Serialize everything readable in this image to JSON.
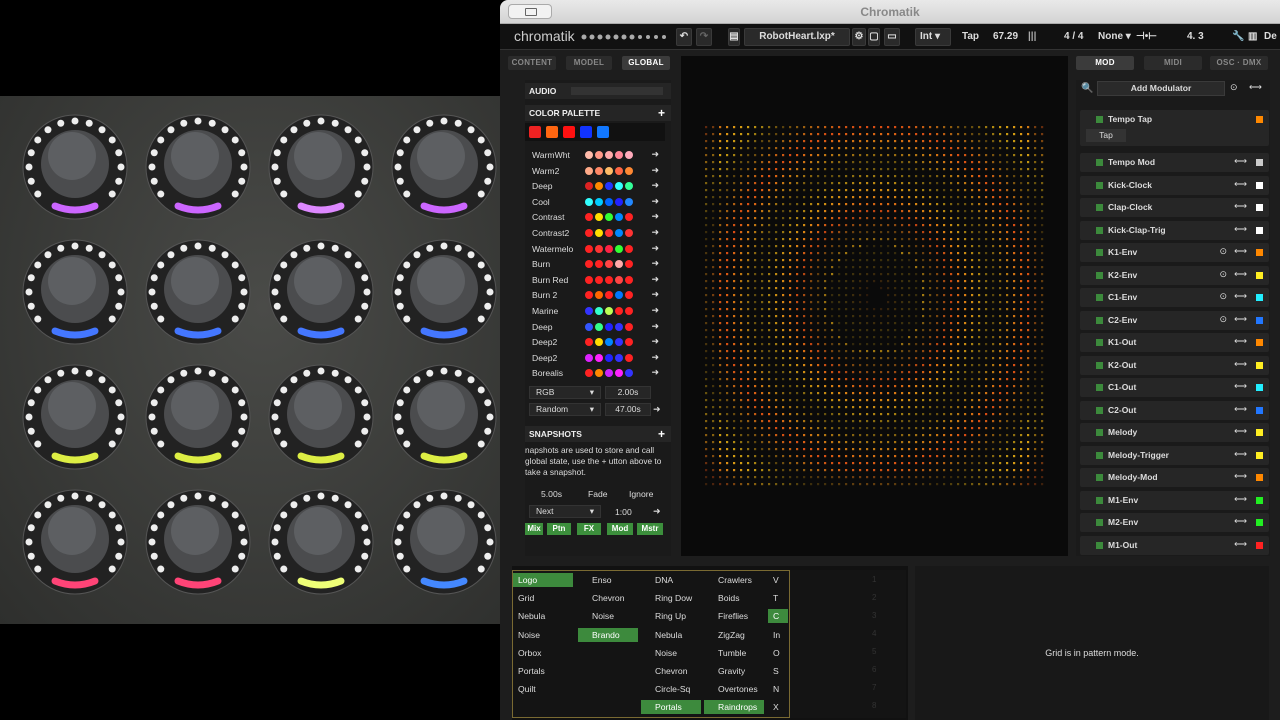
{
  "app": {
    "title": "Chromatik",
    "logo": "chromatik",
    "project": "RobotHeart.lxp*"
  },
  "toolbar": {
    "clock_mode": "Int",
    "tap": "Tap",
    "bpm": "67.29",
    "meter": "4 / 4",
    "sync": "None",
    "beat": "4. 3",
    "edge": "De"
  },
  "left_tabs": [
    "CONTENT",
    "MODEL",
    "GLOBAL"
  ],
  "right_tabs": [
    "MOD",
    "MIDI",
    "OSC · DMX"
  ],
  "audio": {
    "label": "AUDIO"
  },
  "color_palette": {
    "label": "COLOR PALETTE",
    "current": [
      "#ee2222",
      "#ff6611",
      "#ff1111",
      "#1133ff",
      "#1177ff"
    ],
    "palettes": [
      {
        "name": "WarmWht",
        "colors": [
          "#ffbbaa",
          "#ff9988",
          "#ffaaaa",
          "#ff8899",
          "#ffaabb"
        ]
      },
      {
        "name": "Warm2",
        "colors": [
          "#ffaa88",
          "#ff8866",
          "#ffbb66",
          "#ff6644",
          "#ff8833"
        ]
      },
      {
        "name": "Deep",
        "colors": [
          "#dd2222",
          "#ff8800",
          "#2233ff",
          "#33ffff",
          "#33ff99"
        ]
      },
      {
        "name": "Cool",
        "colors": [
          "#33ffff",
          "#00ccff",
          "#0066ff",
          "#2222ff",
          "#2288ff"
        ]
      },
      {
        "name": "Contrast",
        "colors": [
          "#ff2222",
          "#ffdd00",
          "#33ff33",
          "#0088ff",
          "#ff2222"
        ]
      },
      {
        "name": "Contrast2",
        "colors": [
          "#ff2222",
          "#ffdd00",
          "#ff3333",
          "#0088ff",
          "#ff3333"
        ]
      },
      {
        "name": "Watermelo",
        "colors": [
          "#ff2222",
          "#ff3333",
          "#ff2244",
          "#33ff33",
          "#ff2222"
        ]
      },
      {
        "name": "Burn",
        "colors": [
          "#ff2222",
          "#ff2222",
          "#ff4444",
          "#ffaaaa",
          "#ff2222"
        ]
      },
      {
        "name": "Burn Red",
        "colors": [
          "#ff2222",
          "#ff2222",
          "#ff2222",
          "#ff4444",
          "#ff2222"
        ]
      },
      {
        "name": "Burn 2",
        "colors": [
          "#ff2222",
          "#ff6600",
          "#ff2222",
          "#0077ff",
          "#ff2222"
        ]
      },
      {
        "name": "Marine",
        "colors": [
          "#3333ff",
          "#33ffcc",
          "#bbff55",
          "#ff2222",
          "#ff2222"
        ]
      },
      {
        "name": "Deep",
        "colors": [
          "#3355ff",
          "#33ff88",
          "#2222ff",
          "#3333ff",
          "#ff2222"
        ]
      },
      {
        "name": "Deep2",
        "colors": [
          "#ff2222",
          "#ffdd00",
          "#0088ff",
          "#3333ff",
          "#ff2222"
        ]
      },
      {
        "name": "Deep2",
        "colors": [
          "#dd22ff",
          "#ff22ff",
          "#2222ff",
          "#3333ff",
          "#ff2222"
        ]
      },
      {
        "name": "Borealis",
        "colors": [
          "#ff2222",
          "#ff8800",
          "#cc22ff",
          "#ff22ff",
          "#3333ff"
        ]
      }
    ],
    "blend": "RGB",
    "blend_time": "2.00s",
    "mode": "Random",
    "mode_time": "47.00s"
  },
  "snapshots": {
    "label": "SNAPSHOTS",
    "text": "napshots are used to store and call global state, use the + utton above to take a snapshot.",
    "time": "5.00s",
    "fade": "Fade",
    "ignore": "Ignore",
    "next": "Next",
    "ratio": "1:00",
    "buttons": [
      "Mix",
      "Ptn",
      "FX",
      "Mod",
      "Mstr"
    ]
  },
  "modulators": {
    "add_label": "Add Modulator",
    "tempo_tap": "Tempo Tap",
    "tap": "Tap",
    "items": [
      {
        "name": "Tempo Mod",
        "color": "#cccccc"
      },
      {
        "name": "Kick-Clock",
        "color": "#ffffff"
      },
      {
        "name": "Clap-Clock",
        "color": "#ffffff"
      },
      {
        "name": "Kick-Clap-Trig",
        "color": "#ffffff"
      },
      {
        "name": "K1-Env",
        "color": "#ff8800"
      },
      {
        "name": "K2-Env",
        "color": "#ffee22"
      },
      {
        "name": "C1-Env",
        "color": "#22eeff"
      },
      {
        "name": "C2-Env",
        "color": "#2277ff"
      },
      {
        "name": "K1-Out",
        "color": "#ff8800"
      },
      {
        "name": "K2-Out",
        "color": "#ffee22"
      },
      {
        "name": "C1-Out",
        "color": "#22eeff"
      },
      {
        "name": "C2-Out",
        "color": "#2277ff"
      },
      {
        "name": "Melody",
        "color": "#ffee22"
      },
      {
        "name": "Melody-Trigger",
        "color": "#ffee22"
      },
      {
        "name": "Melody-Mod",
        "color": "#ff8800"
      },
      {
        "name": "M1-Env",
        "color": "#22ee22"
      },
      {
        "name": "M2-Env",
        "color": "#22ee22"
      },
      {
        "name": "M1-Out",
        "color": "#ff2222"
      }
    ]
  },
  "pattern_grid": {
    "col1": [
      "Logo",
      "Grid",
      "Nebula",
      "Noise",
      "Orbox",
      "Portals",
      "Quilt"
    ],
    "col2": [
      "Enso",
      "Chevron",
      "Noise",
      "Brando"
    ],
    "col3": [
      "DNA",
      "Ring Dow",
      "Ring Up",
      "Nebula",
      "Noise",
      "Chevron",
      "Circle-Sq",
      "Portals"
    ],
    "col4": [
      "Crawlers",
      "Boids",
      "Fireflies",
      "ZigZag",
      "Tumble",
      "Gravity",
      "Overtones",
      "Raindrops"
    ],
    "col5": [
      "V",
      "T",
      "C",
      "In",
      "O",
      "S",
      "N",
      "X"
    ]
  },
  "grid_message": "Grid is in pattern mode.",
  "knob_colors": [
    "#cc66ff",
    "#cc66ff",
    "#dd88ff",
    "#cc66ff",
    "#4477ff",
    "#4477ff",
    "#4477ff",
    "#4477ff",
    "#ddee44",
    "#ddee44",
    "#ddee44",
    "#ddee44",
    "#ff4477",
    "#ff4477",
    "#eeff77",
    "#4488ff"
  ]
}
